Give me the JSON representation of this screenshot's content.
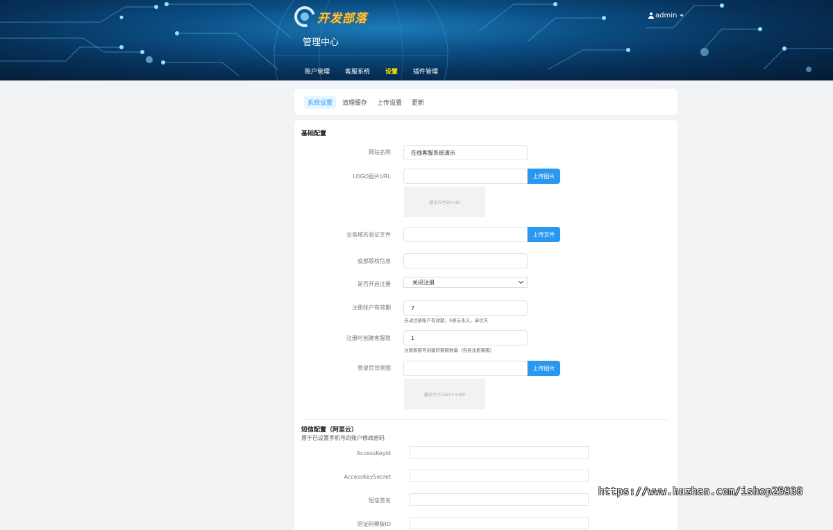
{
  "header": {
    "logo_text": "开发部落",
    "center_title": "管理中心",
    "user": "admin",
    "nav": [
      {
        "label": "账户管理"
      },
      {
        "label": "客服系统"
      },
      {
        "label": "设置"
      },
      {
        "label": "插件管理"
      }
    ]
  },
  "tabs": [
    {
      "label": "系统设置"
    },
    {
      "label": "清理缓存"
    },
    {
      "label": "上传设置"
    },
    {
      "label": "更新"
    }
  ],
  "basic": {
    "title": "基础配置",
    "site_name_label": "网站名称",
    "site_name_value": "在线客服系统演示",
    "logo_label": "LOGO图片URL",
    "upload_image": "上传图片",
    "logo_preview": "建议尺寸90×36",
    "domain_file_label": "业务域名验证文件",
    "upload_file": "上传文件",
    "copyright_label": "底部版权信息",
    "register_label": "是否开启注册",
    "register_value": "关闭注册",
    "validity_label": "注册账户有效期",
    "validity_value": "7",
    "validity_hint": "自动注册账户有效期，0表示永久，单位天",
    "cs_count_label": "注册可创建客服数",
    "cs_count_value": "1",
    "cs_count_hint": "注册客服可创建的客服数量（包括注册客服）",
    "login_bg_label": "登录页背景图",
    "login_bg_preview": "建议尺寸1920×1080"
  },
  "sms": {
    "title": "短信配置（阿里云）",
    "desc": "用于已设置手机号的账户修改密码",
    "access_key_id_label": "AccessKeyId",
    "access_key_secret_label": "AccessKeySecret",
    "sign_label": "短信签名",
    "template_label": "验证码模板ID"
  },
  "watermark": "https://www.huzhan.com/ishop25938",
  "colors": {
    "accent": "#2b98f0",
    "nav_active": "#f5e400",
    "tab_active": "#1e9fff"
  }
}
